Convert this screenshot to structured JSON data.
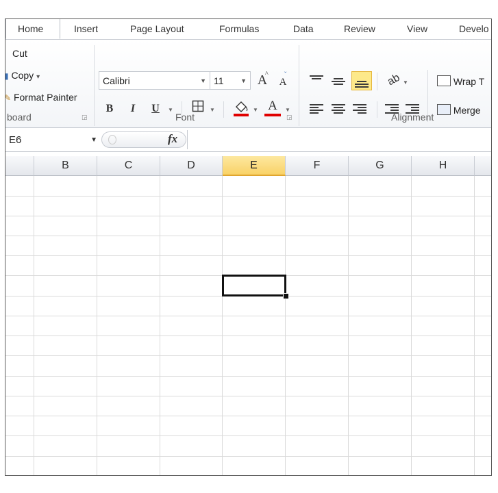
{
  "tabs": [
    "Home",
    "Insert",
    "Page Layout",
    "Formulas",
    "Data",
    "Review",
    "View",
    "Develo"
  ],
  "clipboard": {
    "cut": "Cut",
    "copy": "Copy",
    "copy_arrow": "▾",
    "format_painter": "Format Painter",
    "group_label": "board"
  },
  "font": {
    "family": "Calibri",
    "size": "11",
    "bold": "B",
    "italic": "I",
    "underline": "U",
    "grow": "A",
    "shrink": "A",
    "font_color": "A",
    "fill_color_hex": "#e00000",
    "font_color_hex": "#e00000",
    "group_label": "Font"
  },
  "alignment": {
    "wrap_text": "Wrap T",
    "merge": "Merge",
    "group_label": "Alignment",
    "active_button": "bottom-align",
    "highlight_hex": "#fde98a"
  },
  "formula_bar": {
    "name_box": "E6",
    "fx": "fx",
    "value": ""
  },
  "columns": [
    "B",
    "C",
    "D",
    "E",
    "F",
    "G",
    "H"
  ],
  "selected_column": "E",
  "selected_cell": "E6",
  "icons": {
    "cut": "scissors-icon",
    "copy": "copy-icon",
    "format_painter": "paintbrush-icon",
    "borders": "borders-icon",
    "fill": "paint-bucket-icon",
    "orientation": "text-orientation-icon",
    "wrap": "wrap-text-icon",
    "merge": "merge-center-icon"
  }
}
